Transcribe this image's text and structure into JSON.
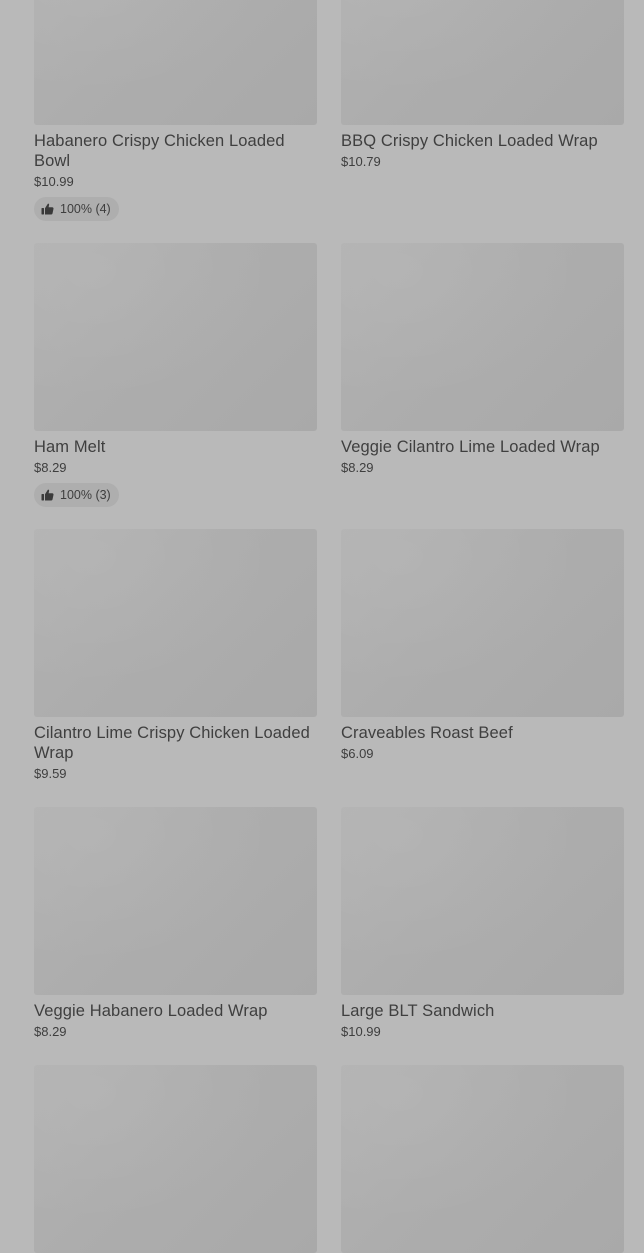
{
  "items": [
    {
      "name": "Habanero Crispy Chicken Loaded Bowl",
      "price": "$10.99",
      "rating": "100% (4)"
    },
    {
      "name": "BBQ Crispy Chicken Loaded Wrap",
      "price": "$10.79"
    },
    {
      "name": "Ham Melt",
      "price": "$8.29",
      "rating": "100% (3)"
    },
    {
      "name": "Veggie Cilantro Lime Loaded Wrap",
      "price": "$8.29"
    },
    {
      "name": "Cilantro Lime Crispy Chicken Loaded Wrap",
      "price": "$9.59"
    },
    {
      "name": "Craveables Roast Beef",
      "price": "$6.09"
    },
    {
      "name": "Veggie Habanero Loaded Wrap",
      "price": "$8.29"
    },
    {
      "name": "Large BLT Sandwich",
      "price": "$10.99"
    }
  ],
  "icons": {
    "rating": "thumbs-up-icon"
  }
}
